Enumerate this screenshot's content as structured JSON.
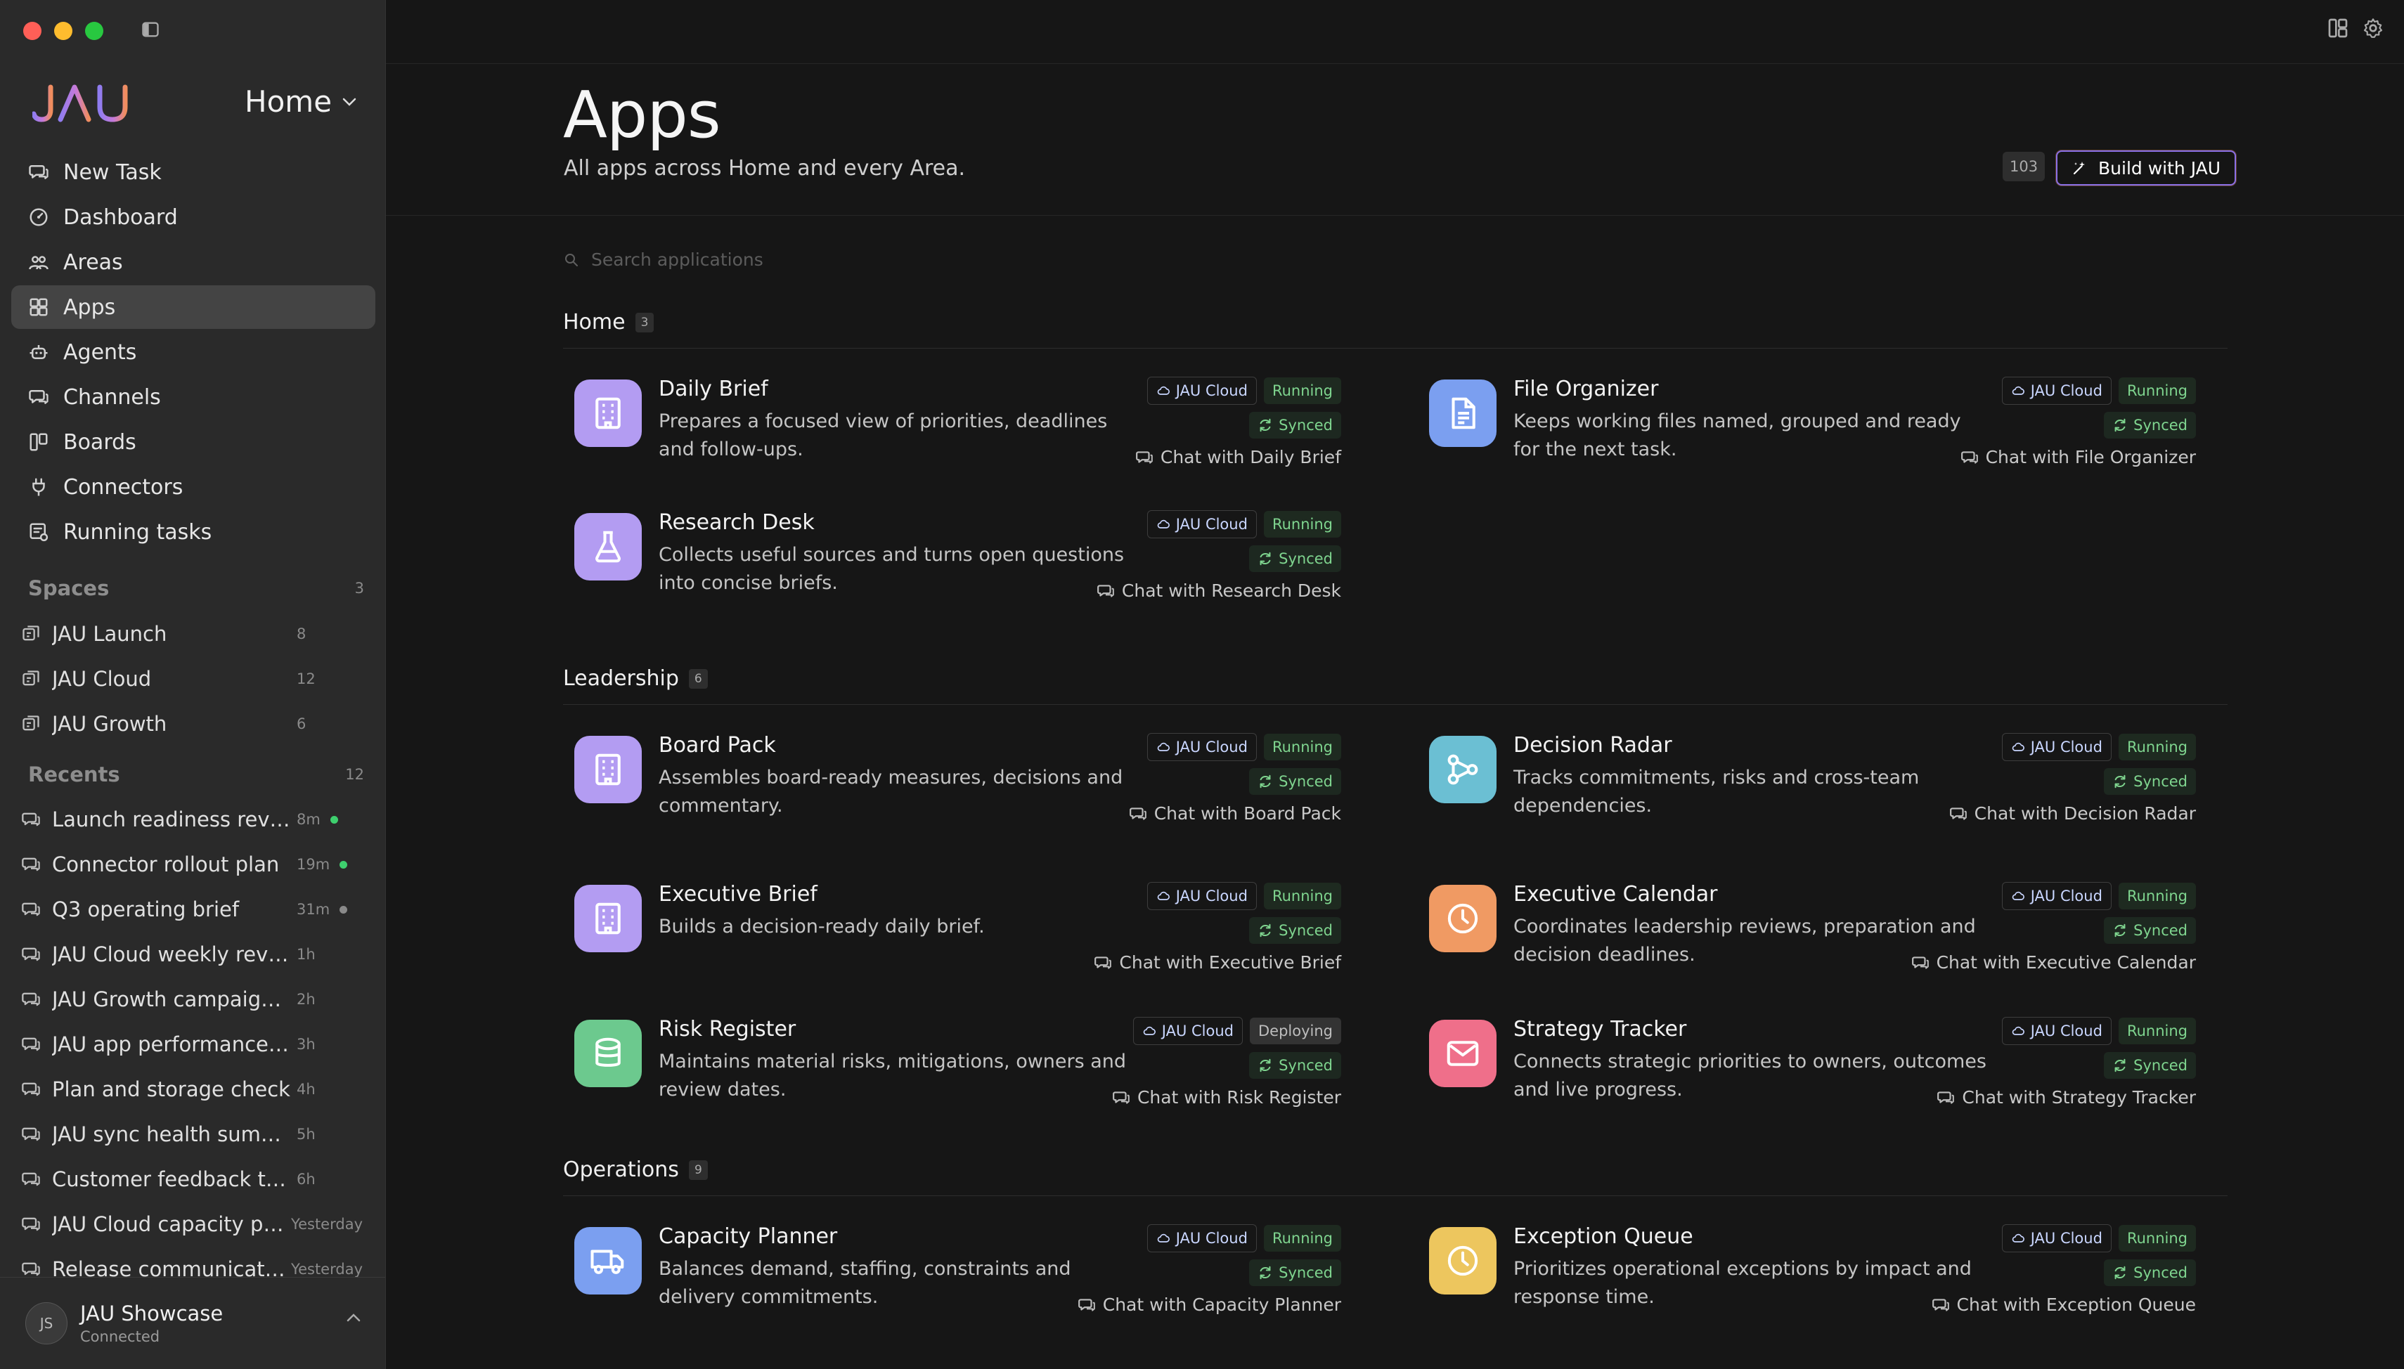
{
  "colors": {
    "sidebar_bg": "#2a2a2a",
    "main_bg": "#161616",
    "accent": "#8a6fe6",
    "running": "#7fd58f",
    "dot_green": "#3ecf6e",
    "dot_gray": "#8a8a8a"
  },
  "brand": {
    "logo_text": "JAU"
  },
  "workspace": {
    "label": "Home"
  },
  "nav": [
    {
      "label": "New Task",
      "icon": "chat-icon"
    },
    {
      "label": "Dashboard",
      "icon": "gauge-icon"
    },
    {
      "label": "Areas",
      "icon": "people-icon"
    },
    {
      "label": "Apps",
      "icon": "grid-icon",
      "active": true
    },
    {
      "label": "Agents",
      "icon": "bot-icon"
    },
    {
      "label": "Channels",
      "icon": "chat-icon"
    },
    {
      "label": "Boards",
      "icon": "board-icon"
    },
    {
      "label": "Connectors",
      "icon": "plug-icon"
    },
    {
      "label": "Running tasks",
      "icon": "tasks-icon"
    }
  ],
  "spaces": {
    "label": "Spaces",
    "count": "3",
    "items": [
      {
        "label": "JAU Launch",
        "count": "8"
      },
      {
        "label": "JAU Cloud",
        "count": "12"
      },
      {
        "label": "JAU Growth",
        "count": "6"
      }
    ]
  },
  "recents": {
    "label": "Recents",
    "count": "12",
    "items": [
      {
        "label": "Launch readiness review",
        "time": "8m",
        "dot": "green"
      },
      {
        "label": "Connector rollout plan",
        "time": "19m",
        "dot": "green"
      },
      {
        "label": "Q3 operating brief",
        "time": "31m",
        "dot": "gray"
      },
      {
        "label": "JAU Cloud weekly review",
        "time": "1h"
      },
      {
        "label": "JAU Growth campaign plan",
        "time": "2h"
      },
      {
        "label": "JAU app performance review",
        "time": "3h"
      },
      {
        "label": "Plan and storage check",
        "time": "4h"
      },
      {
        "label": "JAU sync health summary",
        "time": "5h"
      },
      {
        "label": "Customer feedback themes",
        "time": "6h"
      },
      {
        "label": "JAU Cloud capacity plan",
        "time": "Yesterday"
      },
      {
        "label": "Release communicatio…",
        "time": "Yesterday"
      }
    ]
  },
  "user": {
    "initials": "JS",
    "name": "JAU Showcase",
    "status": "Connected"
  },
  "page": {
    "title": "Apps",
    "subtitle": "All apps across Home and every Area.",
    "count": "103",
    "build_label": "Build with JAU",
    "search_placeholder": "Search applications"
  },
  "groups": [
    {
      "name": "Home",
      "count": "3",
      "apps": [
        {
          "name": "Daily Brief",
          "desc": "Prepares a focused view of priorities, deadlines and follow-ups.",
          "cloud": "JAU Cloud",
          "status": "Running",
          "sync": "Synced",
          "chat": "Chat with Daily Brief",
          "icon": "building-icon",
          "color": "#b39cf2"
        },
        {
          "name": "File Organizer",
          "desc": "Keeps working files named, grouped and ready for the next task.",
          "cloud": "JAU Cloud",
          "status": "Running",
          "sync": "Synced",
          "chat": "Chat with File Organizer",
          "icon": "document-icon",
          "color": "#7b9ff0"
        },
        {
          "name": "Research Desk",
          "desc": "Collects useful sources and turns open questions into concise briefs.",
          "cloud": "JAU Cloud",
          "status": "Running",
          "sync": "Synced",
          "chat": "Chat with Research Desk",
          "icon": "flask-icon",
          "color": "#b39cf2"
        }
      ]
    },
    {
      "name": "Leadership",
      "count": "6",
      "apps": [
        {
          "name": "Board Pack",
          "desc": "Assembles board-ready measures, decisions and commentary.",
          "cloud": "JAU Cloud",
          "status": "Running",
          "sync": "Synced",
          "chat": "Chat with Board Pack",
          "icon": "building-icon",
          "color": "#b39cf2"
        },
        {
          "name": "Decision Radar",
          "desc": "Tracks commitments, risks and cross-team dependencies.",
          "cloud": "JAU Cloud",
          "status": "Running",
          "sync": "Synced",
          "chat": "Chat with Decision Radar",
          "icon": "network-icon",
          "color": "#6bbfd3"
        },
        {
          "name": "Executive Brief",
          "desc": "Builds a decision-ready daily brief.",
          "cloud": "JAU Cloud",
          "status": "Running",
          "sync": "Synced",
          "chat": "Chat with Executive Brief",
          "icon": "building-icon",
          "color": "#b39cf2"
        },
        {
          "name": "Executive Calendar",
          "desc": "Coordinates leadership reviews, preparation and decision deadlines.",
          "cloud": "JAU Cloud",
          "status": "Running",
          "sync": "Synced",
          "chat": "Chat with Executive Calendar",
          "icon": "clock-icon",
          "color": "#f09a63"
        },
        {
          "name": "Risk Register",
          "desc": "Maintains material risks, mitigations, owners and review dates.",
          "cloud": "JAU Cloud",
          "status": "Deploying",
          "sync": "Synced",
          "chat": "Chat with Risk Register",
          "icon": "database-icon",
          "color": "#6cc98e"
        },
        {
          "name": "Strategy Tracker",
          "desc": "Connects strategic priorities to owners, outcomes and live progress.",
          "cloud": "JAU Cloud",
          "status": "Running",
          "sync": "Synced",
          "chat": "Chat with Strategy Tracker",
          "icon": "mail-icon",
          "color": "#ef6f8a"
        }
      ]
    },
    {
      "name": "Operations",
      "count": "9",
      "apps": [
        {
          "name": "Capacity Planner",
          "desc": "Balances demand, staffing, constraints and delivery commitments.",
          "cloud": "JAU Cloud",
          "status": "Running",
          "sync": "Synced",
          "chat": "Chat with Capacity Planner",
          "icon": "truck-icon",
          "color": "#7b9ff0"
        },
        {
          "name": "Exception Queue",
          "desc": "Prioritizes operational exceptions by impact and response time.",
          "cloud": "JAU Cloud",
          "status": "Running",
          "sync": "Synced",
          "chat": "Chat with Exception Queue",
          "icon": "clock-icon",
          "color": "#edc65e"
        }
      ]
    }
  ]
}
